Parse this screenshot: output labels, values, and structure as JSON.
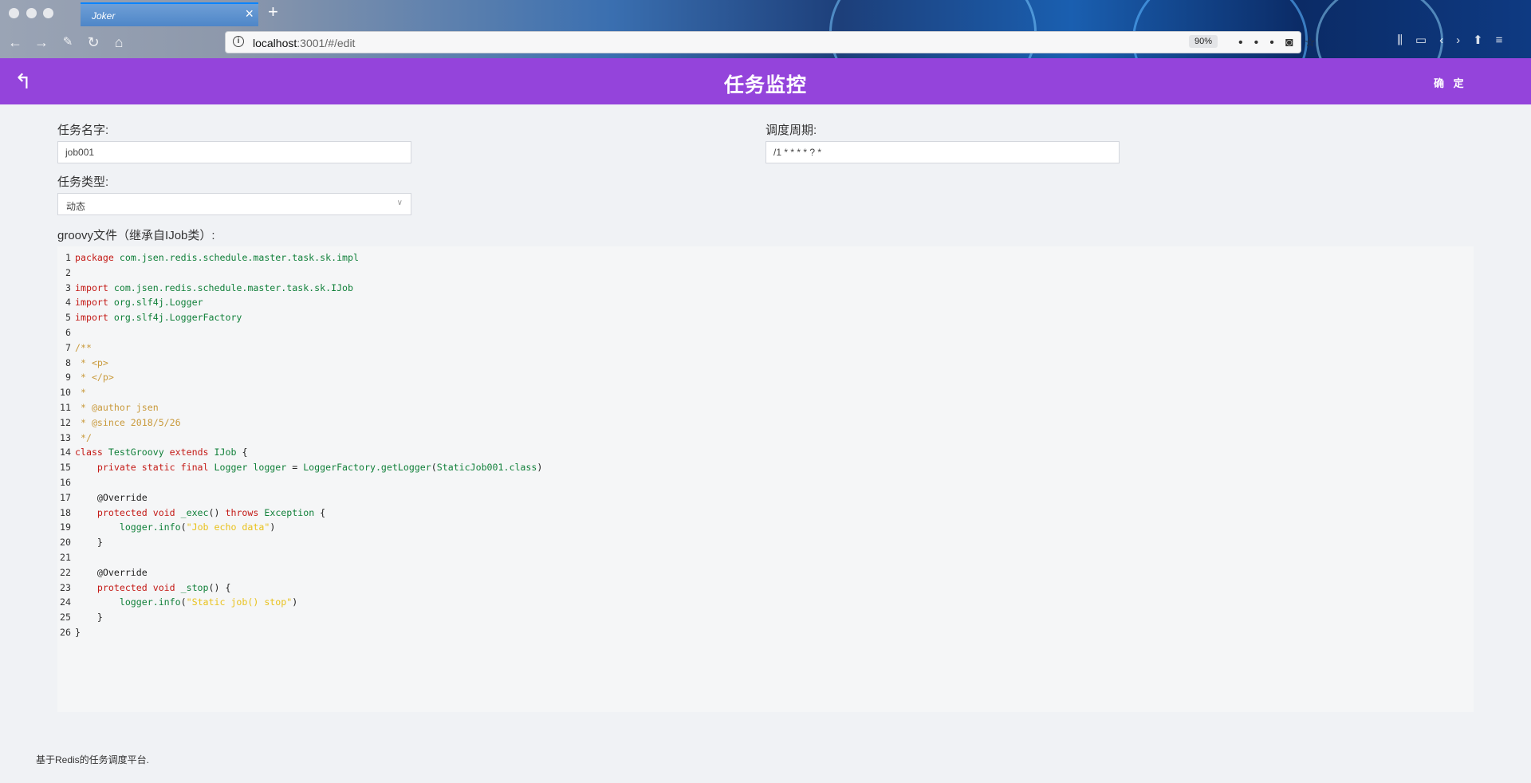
{
  "browser": {
    "tab_title": "Joker",
    "tab_close": "×",
    "new_tab": "+",
    "url_host": "localhost",
    "url_rest": ":3001/#/edit",
    "zoom": "90%",
    "icons": [
      "back-icon",
      "forward-icon",
      "tools-icon",
      "reload-icon",
      "home-icon",
      "more-icon",
      "pocket-icon",
      "bookmark-star-icon",
      "library-icon",
      "sidebar-icon",
      "devtools-icon",
      "extension-icon",
      "menu-icon"
    ]
  },
  "header": {
    "back_icon": "↰",
    "title": "任务监控",
    "confirm_label": "确 定",
    "color": "#9444db"
  },
  "form": {
    "job_name_label": "任务名字:",
    "job_name_value": "job001",
    "cron_label": "调度周期:",
    "cron_value": "/1 * * * * ? *",
    "job_type_label": "任务类型:",
    "job_type_value": "动态",
    "groovy_label": "groovy文件（继承自IJob类）:"
  },
  "editor": {
    "lines": [
      [
        {
          "t": "package",
          "c": "kw"
        },
        {
          "t": " com.jsen.redis.schedule.master.task.sk.impl",
          "c": "pkg"
        }
      ],
      [],
      [
        {
          "t": "import",
          "c": "kw"
        },
        {
          "t": " com.jsen.redis.schedule.master.task.sk.IJob",
          "c": "pkg"
        }
      ],
      [
        {
          "t": "import",
          "c": "kw"
        },
        {
          "t": " org.slf4j.Logger",
          "c": "pkg"
        }
      ],
      [
        {
          "t": "import",
          "c": "kw"
        },
        {
          "t": " org.slf4j.LoggerFactory",
          "c": "pkg"
        }
      ],
      [],
      [
        {
          "t": "/**",
          "c": "cmt"
        }
      ],
      [
        {
          "t": " * <p>",
          "c": "cmt"
        }
      ],
      [
        {
          "t": " * </p>",
          "c": "cmt"
        }
      ],
      [
        {
          "t": " *",
          "c": "cmt"
        }
      ],
      [
        {
          "t": " * @author jsen",
          "c": "cmt"
        }
      ],
      [
        {
          "t": " * @since 2018/5/26",
          "c": "cmt"
        }
      ],
      [
        {
          "t": " */",
          "c": "cmt"
        }
      ],
      [
        {
          "t": "class",
          "c": "kw"
        },
        {
          "t": " TestGroovy ",
          "c": "pkg"
        },
        {
          "t": "extends",
          "c": "kw"
        },
        {
          "t": " IJob ",
          "c": "pkg"
        },
        {
          "t": "{",
          "c": "plain"
        }
      ],
      [
        {
          "t": "    private static final",
          "c": "kw"
        },
        {
          "t": " Logger logger ",
          "c": "pkg"
        },
        {
          "t": "=",
          "c": "plain"
        },
        {
          "t": " LoggerFactory.getLogger",
          "c": "pkg"
        },
        {
          "t": "(",
          "c": "plain"
        },
        {
          "t": "StaticJob001.class",
          "c": "pkg"
        },
        {
          "t": ")",
          "c": "plain"
        }
      ],
      [],
      [
        {
          "t": "    @Override",
          "c": "ann"
        }
      ],
      [
        {
          "t": "    protected void",
          "c": "kw"
        },
        {
          "t": " _exec",
          "c": "pkg"
        },
        {
          "t": "() ",
          "c": "plain"
        },
        {
          "t": "throws",
          "c": "kw"
        },
        {
          "t": " Exception ",
          "c": "pkg"
        },
        {
          "t": "{",
          "c": "plain"
        }
      ],
      [
        {
          "t": "        logger.info",
          "c": "pkg"
        },
        {
          "t": "(",
          "c": "plain"
        },
        {
          "t": "\"Job echo data\"",
          "c": "str"
        },
        {
          "t": ")",
          "c": "plain"
        }
      ],
      [
        {
          "t": "    }",
          "c": "plain"
        }
      ],
      [],
      [
        {
          "t": "    @Override",
          "c": "ann"
        }
      ],
      [
        {
          "t": "    protected void",
          "c": "kw"
        },
        {
          "t": " _stop",
          "c": "pkg"
        },
        {
          "t": "() {",
          "c": "plain"
        }
      ],
      [
        {
          "t": "        logger.info",
          "c": "pkg"
        },
        {
          "t": "(",
          "c": "plain"
        },
        {
          "t": "\"Static job() stop\"",
          "c": "str"
        },
        {
          "t": ")",
          "c": "plain"
        }
      ],
      [
        {
          "t": "    }",
          "c": "plain"
        }
      ],
      [
        {
          "t": "}",
          "c": "plain"
        }
      ]
    ]
  },
  "footer": {
    "text": "基于Redis的任务调度平台."
  }
}
